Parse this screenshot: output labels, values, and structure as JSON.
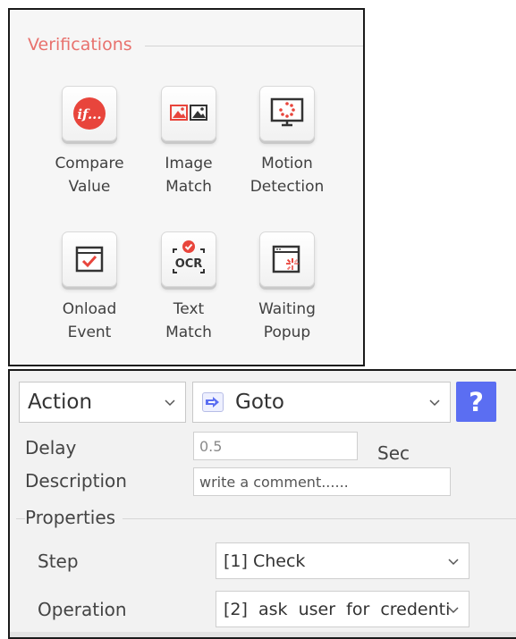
{
  "verifications": {
    "title": "Verifications",
    "tools": [
      {
        "line1": "Compare",
        "line2": "Value",
        "icon": "compare-value-icon",
        "glyph": "if..."
      },
      {
        "line1": "Image",
        "line2": "Match",
        "icon": "image-match-icon"
      },
      {
        "line1": "Motion",
        "line2": "Detection",
        "icon": "motion-detection-icon"
      },
      {
        "line1": "Onload",
        "line2": "Event",
        "icon": "onload-event-icon"
      },
      {
        "line1": "Text",
        "line2": "Match",
        "icon": "text-match-icon",
        "glyph": "OCR"
      },
      {
        "line1": "Waiting",
        "line2": "Popup",
        "icon": "waiting-popup-icon"
      }
    ]
  },
  "action_panel": {
    "action_select": "Action",
    "command_select": "Goto",
    "help_label": "?",
    "delay_label": "Delay",
    "delay_value": "0.5",
    "delay_unit": "Sec",
    "description_label": "Description",
    "description_placeholder": "write a comment......",
    "properties_title": "Properties",
    "step_label": "Step",
    "step_value": "[1] Check",
    "operation_label": "Operation",
    "operation_value": "[2]  ask  user  for  credenti"
  },
  "colors": {
    "section_title": "#e8716d",
    "icon_red": "#e8453c",
    "help_button": "#5b6ef2"
  }
}
